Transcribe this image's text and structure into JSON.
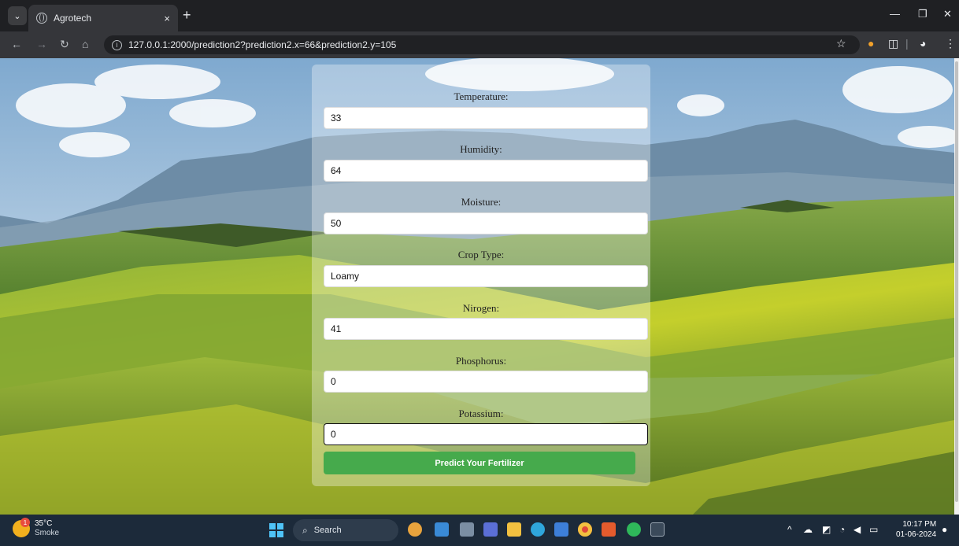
{
  "browser": {
    "tab_title": "Agrotech",
    "tab_close": "×",
    "new_tab": "+",
    "url": "127.0.0.1:2000/prediction2?prediction2.x=66&prediction2.y=105"
  },
  "form": {
    "fields": [
      {
        "label": "Temperature:",
        "value": "33"
      },
      {
        "label": "Humidity:",
        "value": "64"
      },
      {
        "label": "Moisture:",
        "value": "50"
      },
      {
        "label": "Crop Type:",
        "value": "Loamy"
      },
      {
        "label": "Nirogen:",
        "value": "41"
      },
      {
        "label": "Phosphorus:",
        "value": "0"
      },
      {
        "label": "Potassium:",
        "value": "0"
      }
    ],
    "submit_label": "Predict Your Fertilizer"
  },
  "taskbar": {
    "weather_temp": "35°C",
    "weather_desc": "Smoke",
    "weather_badge": "1",
    "search_label": "Search",
    "time": "10:17 PM",
    "date": "01-06-2024"
  }
}
